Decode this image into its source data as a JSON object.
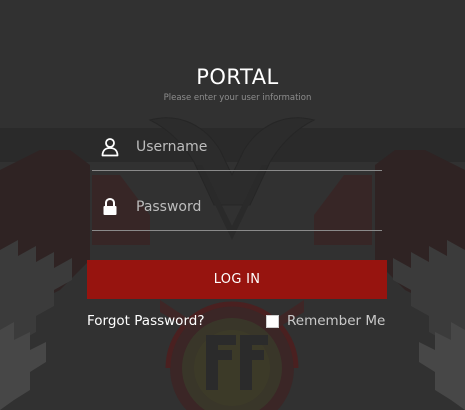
{
  "portal": {
    "title": "PORTAL",
    "subtitle": "Please enter your user information"
  },
  "username": {
    "placeholder": "Username",
    "value": "",
    "icon": "user-icon"
  },
  "password": {
    "placeholder": "Password",
    "value": "",
    "icon": "lock-icon"
  },
  "login_button": {
    "label": "LOG IN"
  },
  "forgot_link": {
    "label": "Forgot Password?"
  },
  "remember_me": {
    "label": "Remember Me",
    "checked": false
  },
  "colors": {
    "background": "#313131",
    "accent": "#97140f",
    "text": "#ffffff",
    "muted_text": "#8d8d8d",
    "divider": "#8a8a8a"
  }
}
